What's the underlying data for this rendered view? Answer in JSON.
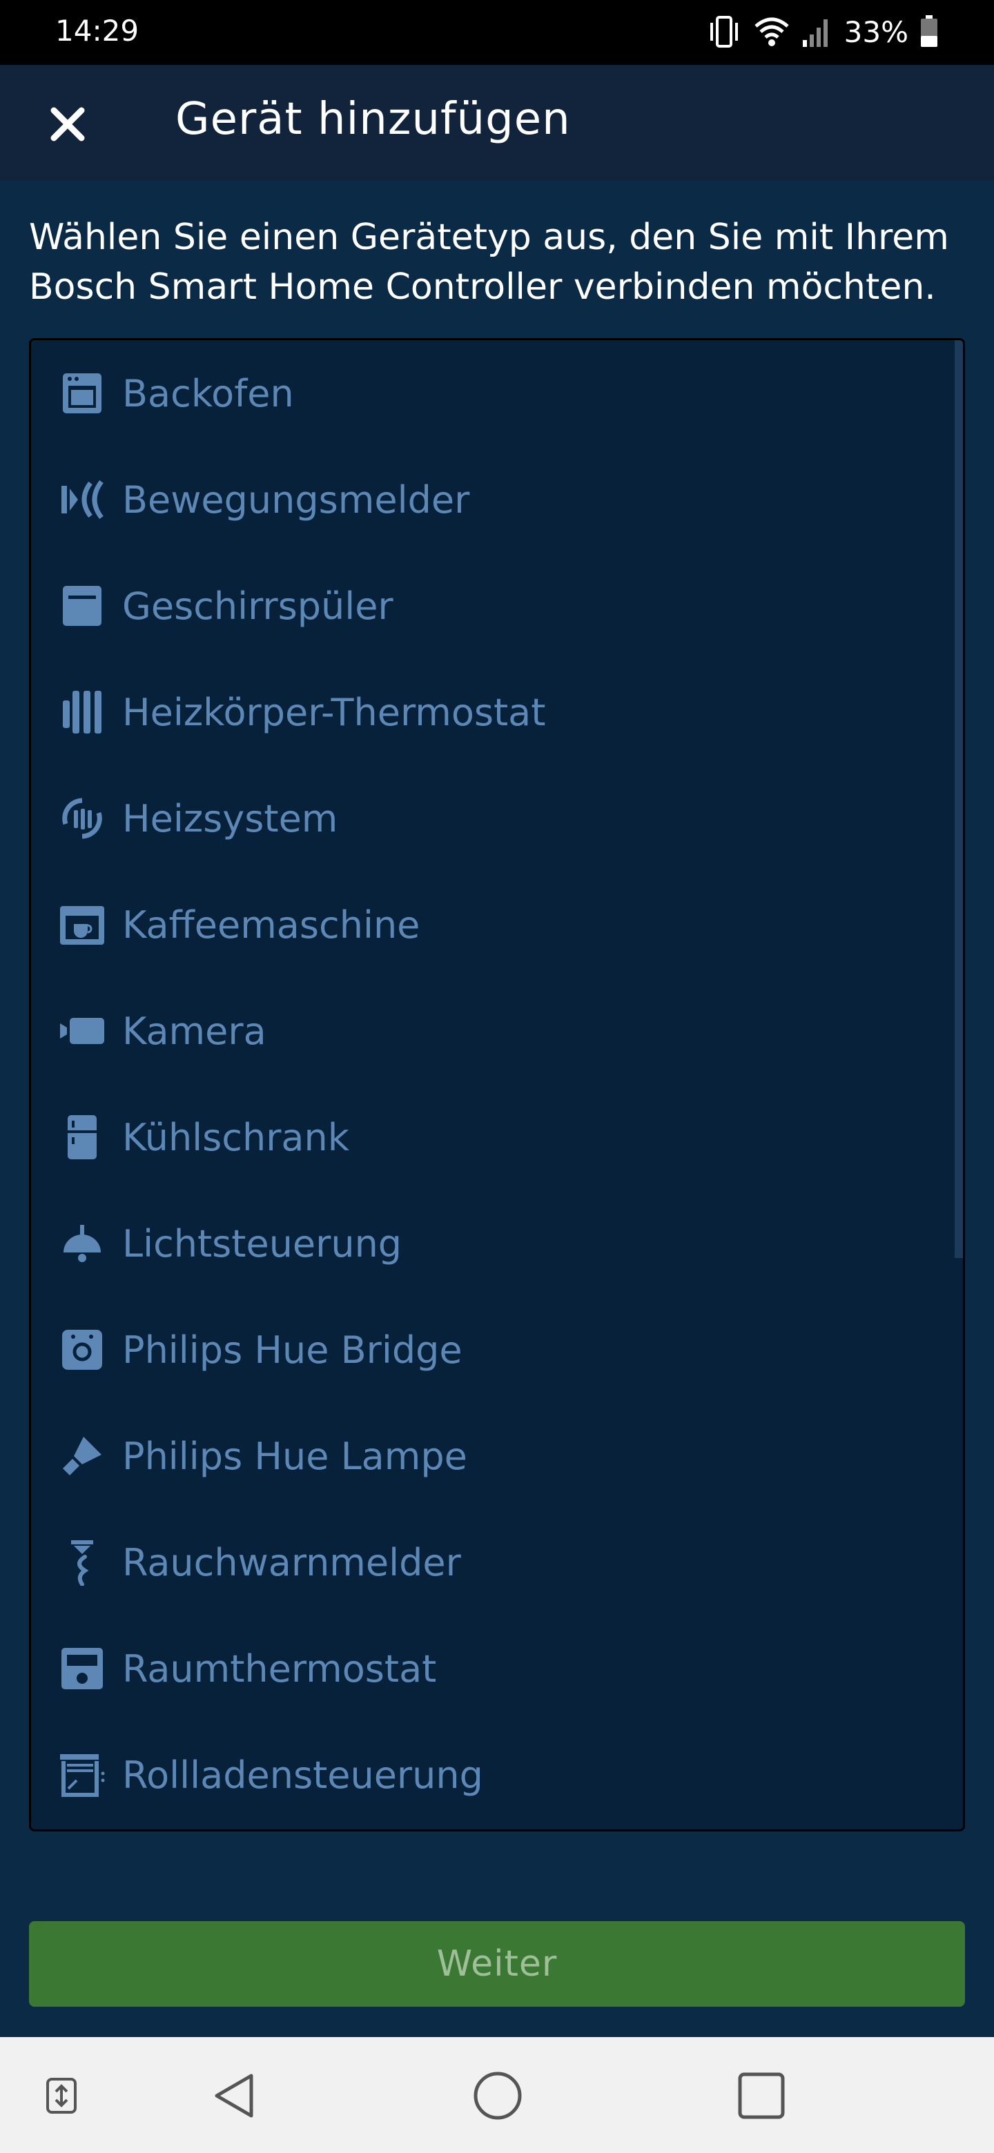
{
  "status_bar": {
    "time": "14:29",
    "battery": "33%",
    "icons": [
      "vibrate-icon",
      "wifi-icon",
      "signal-icon",
      "battery-icon"
    ]
  },
  "app_bar": {
    "title": "Gerät hinzufügen",
    "close_icon": "close-icon"
  },
  "description": "Wählen Sie einen Gerätetyp aus, den Sie mit Ihrem Bosch Smart Home Controller verbinden möchten.",
  "device_list": {
    "items": [
      {
        "label": "Backofen",
        "icon": "oven-icon"
      },
      {
        "label": "Bewegungsmelder",
        "icon": "motion-sensor-icon"
      },
      {
        "label": "Geschirrspüler",
        "icon": "dishwasher-icon"
      },
      {
        "label": "Heizkörper-Thermostat",
        "icon": "radiator-thermostat-icon"
      },
      {
        "label": "Heizsystem",
        "icon": "heating-system-icon"
      },
      {
        "label": "Kaffeemaschine",
        "icon": "coffee-machine-icon"
      },
      {
        "label": "Kamera",
        "icon": "camera-icon"
      },
      {
        "label": "Kühlschrank",
        "icon": "fridge-icon"
      },
      {
        "label": "Lichtsteuerung",
        "icon": "ceiling-lamp-icon"
      },
      {
        "label": "Philips Hue Bridge",
        "icon": "hue-bridge-icon"
      },
      {
        "label": "Philips Hue Lampe",
        "icon": "hue-lamp-icon"
      },
      {
        "label": "Rauchwarnmelder",
        "icon": "smoke-detector-icon"
      },
      {
        "label": "Raumthermostat",
        "icon": "room-thermostat-icon"
      },
      {
        "label": "Rollladensteuerung",
        "icon": "shutter-control-icon"
      }
    ]
  },
  "primary_button": {
    "label": "Weiter"
  },
  "nav_bar": {
    "icons": [
      "recent-apps-switch-icon",
      "back-icon",
      "home-icon",
      "overview-icon"
    ]
  },
  "colors": {
    "background": "#0b2a46",
    "app_bar": "#12243b",
    "list_bg": "#07213a",
    "item_text": "#5d88b6",
    "button_bg": "#3b7834",
    "button_text": "#9fbf99"
  }
}
